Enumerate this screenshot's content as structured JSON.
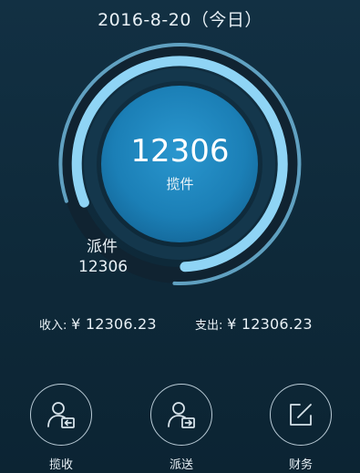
{
  "header": {
    "date_title": "2016-8-20（今日）"
  },
  "dial": {
    "pickup_count": "12306",
    "pickup_label": "揽件",
    "dispatch_label": "派件",
    "dispatch_count": "12306"
  },
  "finance": {
    "income_label": "收入:",
    "income_value": "¥ 12306.23",
    "expense_label": "支出:",
    "expense_value": "¥ 12306.23"
  },
  "actions": [
    {
      "label": "揽收",
      "icon": "user-in-icon"
    },
    {
      "label": "派送",
      "icon": "user-out-icon"
    },
    {
      "label": "财务",
      "icon": "edit-square-icon"
    }
  ],
  "colors": {
    "background": "#0f2a3a",
    "ring_light": "#8fd4f5",
    "center_disc": "#1980b8",
    "icon_stroke": "#b9cbd6"
  }
}
